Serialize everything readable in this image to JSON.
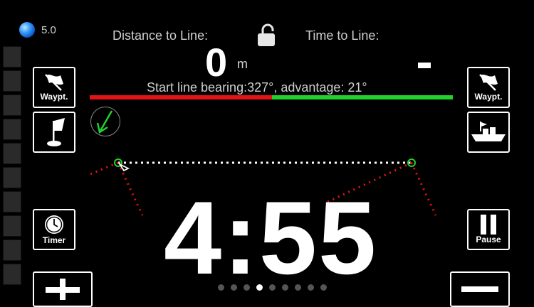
{
  "status": {
    "version": "5.0"
  },
  "header": {
    "distance_label": "Distance to Line:",
    "time_label": "Time to Line:",
    "distance_value": "0",
    "distance_unit": "m",
    "time_value": "-"
  },
  "bearing": {
    "text": "Start line bearing:327°, advantage:  21°"
  },
  "buttons": {
    "waypoint_left": "Waypt.",
    "waypoint_right": "Waypt.",
    "timer": "Timer",
    "pause": "Pause"
  },
  "countdown": {
    "value": "4:55"
  },
  "pager": {
    "count": 9,
    "active_index": 3
  },
  "colors": {
    "port": "#e41414",
    "starboard": "#22d12c",
    "mark": "#22d12c",
    "wind_arrow": "#22d12c"
  },
  "icons": {
    "gps": "gps-status-icon",
    "lock": "unlock-icon",
    "flag": "flag-icon",
    "pin": "pin-flag-icon",
    "boat": "boat-icon",
    "clock": "clock-icon",
    "wind": "wind-arrow-icon"
  }
}
